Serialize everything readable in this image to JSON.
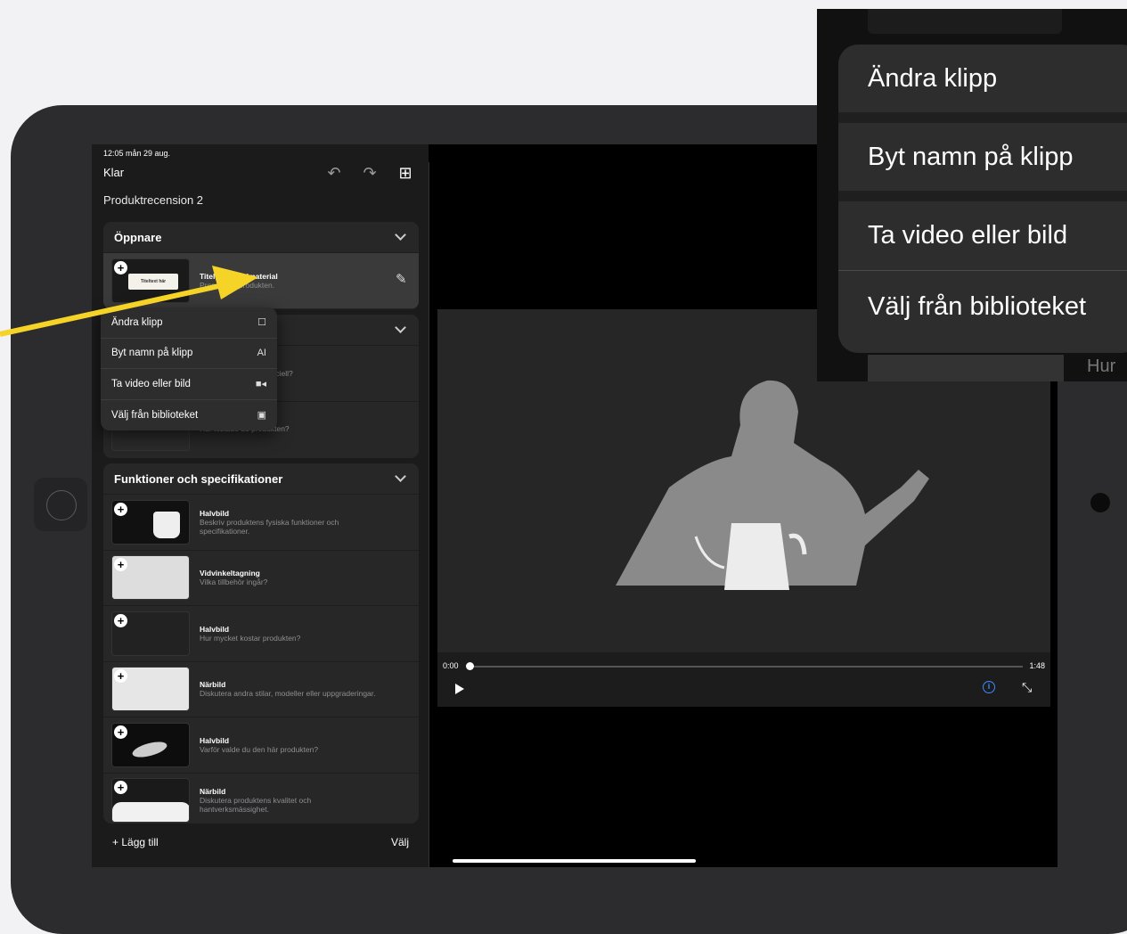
{
  "status_bar": {
    "time_date": "12:05  mån 29 aug."
  },
  "toolbar": {
    "done_label": "Klar"
  },
  "project": {
    "title": "Produktrecension 2"
  },
  "sections": [
    {
      "title": "Öppnare",
      "clips": [
        {
          "title": "Titel över bildmaterial",
          "subtitle": "Presentera produkten."
        }
      ]
    },
    {
      "title": "",
      "clips": [
        {
          "title": "",
          "subtitle": "Vad gör produkten speciell?"
        },
        {
          "title": "",
          "subtitle": "Hur testade du produkten?"
        }
      ]
    },
    {
      "title": "Funktioner och specifikationer",
      "clips": [
        {
          "title": "Halvbild",
          "subtitle": "Beskriv produktens fysiska funktioner och specifikationer."
        },
        {
          "title": "Vidvinkeltagning",
          "subtitle": "Vilka tillbehör ingår?"
        },
        {
          "title": "Halvbild",
          "subtitle": "Hur mycket kostar produkten?"
        },
        {
          "title": "Närbild",
          "subtitle": "Diskutera andra stilar, modeller eller uppgraderingar."
        },
        {
          "title": "Halvbild",
          "subtitle": "Varför valde du den här produkten?"
        },
        {
          "title": "Närbild",
          "subtitle": "Diskutera produktens kvalitet och hantverksmässighet."
        }
      ]
    }
  ],
  "thumb_label": "Titeltext här",
  "context_menu": {
    "items": [
      {
        "label": "Ändra klipp",
        "icon": "edit-icon"
      },
      {
        "label": "Byt namn på klipp",
        "icon": "rename-icon"
      },
      {
        "label": "Ta video eller bild",
        "icon": "video-camera-icon"
      },
      {
        "label": "Välj från biblioteket",
        "icon": "photo-library-icon"
      }
    ]
  },
  "bottom_bar": {
    "add_label": "+ Lägg till",
    "select_label": "Välj"
  },
  "player": {
    "current_time": "0:00",
    "duration": "1:48",
    "progress": 0
  },
  "zoom_callout": {
    "items": [
      "Ändra klipp",
      "Byt namn på klipp",
      "Ta video eller bild",
      "Välj från biblioteket"
    ],
    "peek_text": "Hur"
  },
  "colors": {
    "accent_arrow": "#f5d327",
    "info_blue": "#3d8bff"
  }
}
